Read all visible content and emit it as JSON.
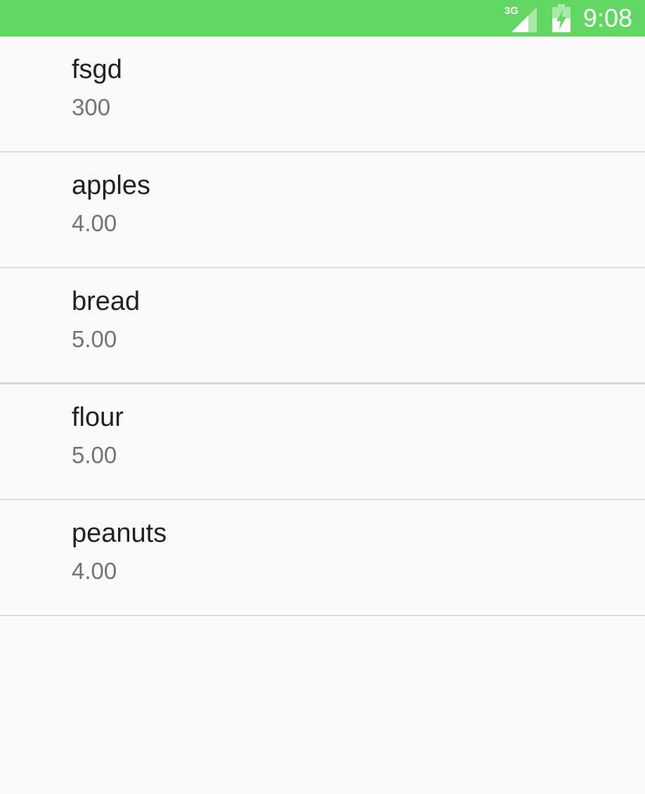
{
  "status_bar": {
    "network_type": "3G",
    "signal_icon": "cell-signal-icon",
    "battery_icon": "battery-charging-icon",
    "time": "9:08",
    "background": "#62d763"
  },
  "items": [
    {
      "name": "fsgd",
      "price": "300"
    },
    {
      "name": "apples",
      "price": "4.00"
    },
    {
      "name": "bread",
      "price": "5.00"
    },
    {
      "name": "flour",
      "price": "5.00"
    },
    {
      "name": "peanuts",
      "price": "4.00"
    }
  ]
}
